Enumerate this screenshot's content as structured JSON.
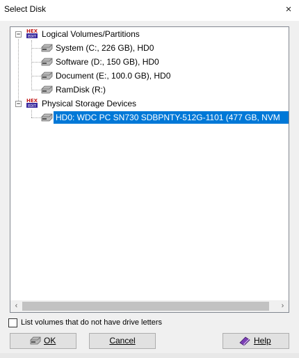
{
  "window": {
    "title": "Select Disk",
    "close_icon": "×"
  },
  "tree": {
    "groups": [
      {
        "label": "Logical Volumes/Partitions",
        "items": [
          {
            "label": "System (C:, 226 GB), HD0"
          },
          {
            "label": "Software (D:, 150 GB), HD0"
          },
          {
            "label": "Document (E:, 100.0 GB), HD0"
          },
          {
            "label": "RamDisk (R:)"
          }
        ]
      },
      {
        "label": "Physical Storage Devices",
        "items": [
          {
            "label": "HD0: WDC PC SN730 SDBPNTY-512G-1101 (477 GB, NVM",
            "selected": true
          }
        ]
      }
    ]
  },
  "options": {
    "no_drive_letter_label": "List volumes that do not have drive letters",
    "checked": false
  },
  "buttons": {
    "ok": "OK",
    "cancel": "Cancel",
    "help": "Help"
  },
  "colors": {
    "selection": "#0078d7",
    "hex_icon": "#6a1b9a"
  }
}
